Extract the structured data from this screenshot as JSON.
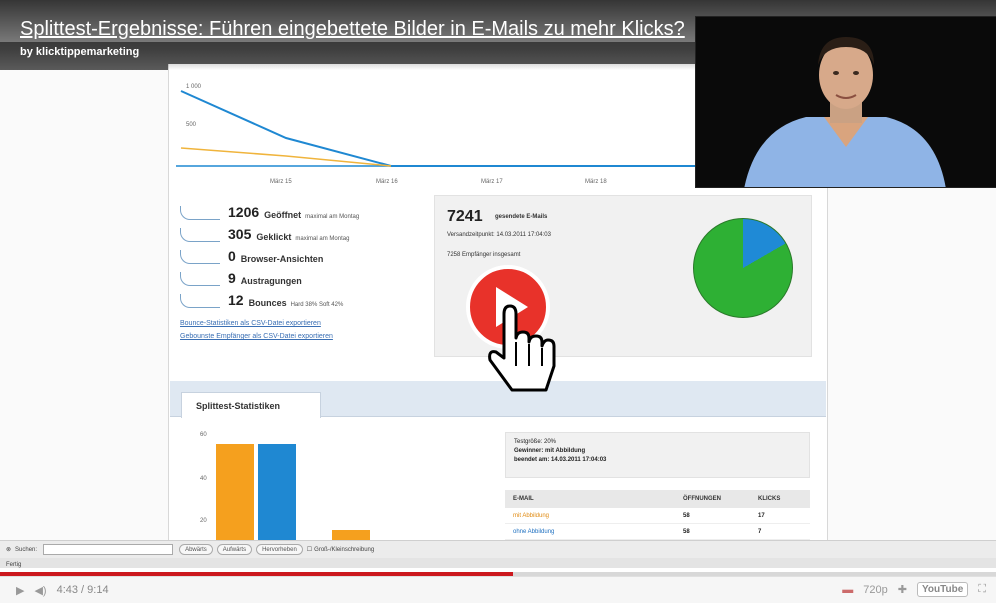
{
  "video": {
    "title": "Splittest-Ergebnisse: Führen eingebettete Bilder in E-Mails zu mehr Klicks?",
    "author": "by klicktippemarketing"
  },
  "line_chart": {
    "ytick_top": "1 000",
    "ytick_mid": "500",
    "xticks": [
      "März 15",
      "März 16",
      "März 17",
      "März 18"
    ]
  },
  "stats": [
    {
      "value": "1206",
      "label": "Geöffnet",
      "note": "maximal am Montag"
    },
    {
      "value": "305",
      "label": "Geklickt",
      "note": "maximal am Montag"
    },
    {
      "value": "0",
      "label": "Browser-Ansichten",
      "note": ""
    },
    {
      "value": "9",
      "label": "Austragungen",
      "note": ""
    },
    {
      "value": "12",
      "label": "Bounces",
      "note": "Hard 38% Soft 42%"
    }
  ],
  "links": {
    "bounce_export": "Bounce-Statistiken als CSV-Datei exportieren",
    "recipients_export": "Gebounste Empfänger als CSV-Datei exportieren"
  },
  "mail": {
    "sent_count": "7241",
    "sent_label": "gesendete E-Mails",
    "send_time": "Versandzeitpunkt: 14.03.2011 17:04:03",
    "recipients_line": "7258 Empfänger insgesamt"
  },
  "split": {
    "tab_label": "Splittest-Statistiken",
    "y_top": "60",
    "y_mid": "40",
    "y_low": "20",
    "info_line1": "Testgröße: 20%",
    "info_line2": "Gewinner: mit Abbildung",
    "info_line3": "beendet am: 14.03.2011 17:04:03",
    "table_headers": [
      "E-MAIL",
      "ÖFFNUNGEN",
      "KLICKS"
    ],
    "table_rows": [
      {
        "email": "mit Abbildung",
        "opens": "58",
        "clicks": "17"
      },
      {
        "email": "ohne Abbildung",
        "opens": "58",
        "clicks": "7"
      }
    ]
  },
  "browser": {
    "find_label": "Suchen:",
    "btn_back": "Abwärts",
    "btn_fwd": "Aufwärts",
    "btn_highlight": "Hervorheben",
    "case_label": "Groß-/Kleinschreibung",
    "status": "Fertig"
  },
  "player": {
    "time": "4:43 / 9:14",
    "quality": "720p",
    "progress_fraction": 0.515,
    "yt_logo": "YouTube"
  },
  "colors": {
    "accent_red": "#cc181e",
    "pie_green": "#2eb034",
    "pie_blue": "#1f8ad6",
    "bar_orange": "#f5a01e",
    "bar_blue": "#1f88d2"
  }
}
